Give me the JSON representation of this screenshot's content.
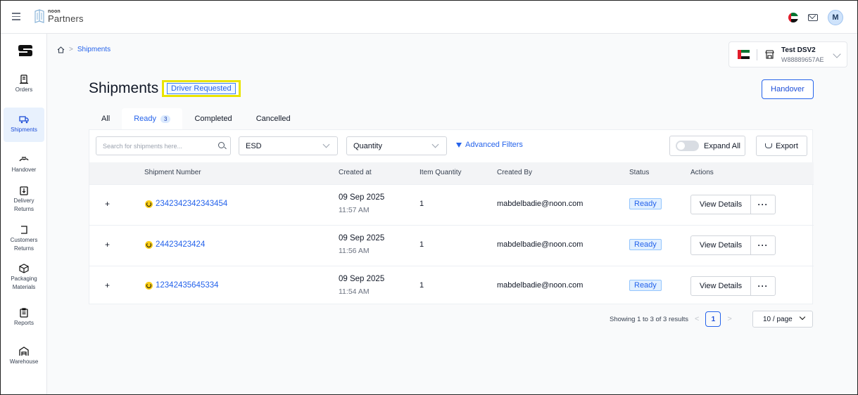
{
  "app": {
    "logo_small": "noon",
    "logo_big": "Partners",
    "avatar_initial": "M"
  },
  "sidebar": {
    "items": [
      {
        "label": "Orders",
        "icon": "orders-icon"
      },
      {
        "label": "Shipments",
        "icon": "truck-icon",
        "active": true
      },
      {
        "label": "Handover",
        "icon": "handover-icon"
      },
      {
        "label": "Delivery Returns",
        "icon": "delivery-returns-icon"
      },
      {
        "label": "Customers Returns",
        "icon": "customer-returns-icon"
      },
      {
        "label": "Packaging Materials",
        "icon": "package-icon"
      },
      {
        "label": "Reports",
        "icon": "reports-icon"
      },
      {
        "label": "Warehouse",
        "icon": "warehouse-icon"
      }
    ]
  },
  "breadcrumb": {
    "current": "Shipments"
  },
  "store": {
    "name": "Test DSV2",
    "id": "W88889657AE"
  },
  "page": {
    "title": "Shipments",
    "status_tag": "Driver Requested",
    "handover_label": "Handover"
  },
  "tabs": [
    {
      "label": "All"
    },
    {
      "label": "Ready",
      "count": "3",
      "active": true
    },
    {
      "label": "Completed"
    },
    {
      "label": "Cancelled"
    }
  ],
  "toolbar": {
    "search_placeholder": "Search for shipments here...",
    "esd_label": "ESD",
    "quantity_label": "Quantity",
    "advanced_filters": "Advanced Filters",
    "expand_all": "Expand All",
    "export": "Export"
  },
  "table": {
    "headers": {
      "shipment": "Shipment Number",
      "created_at": "Created at",
      "qty": "Item Quantity",
      "created_by": "Created By",
      "status": "Status",
      "actions": "Actions"
    },
    "rows": [
      {
        "expand": "+",
        "shipment": "2342342342343454",
        "date": "09 Sep 2025",
        "time": "11:57 AM",
        "qty": "1",
        "created_by": "mabdelbadie@noon.com",
        "status": "Ready",
        "view": "View Details",
        "more": "···"
      },
      {
        "expand": "+",
        "shipment": "24423423424",
        "date": "09 Sep 2025",
        "time": "11:56 AM",
        "qty": "1",
        "created_by": "mabdelbadie@noon.com",
        "status": "Ready",
        "view": "View Details",
        "more": "···"
      },
      {
        "expand": "+",
        "shipment": "12342435645334",
        "date": "09 Sep 2025",
        "time": "11:54 AM",
        "qty": "1",
        "created_by": "mabdelbadie@noon.com",
        "status": "Ready",
        "view": "View Details",
        "more": "···"
      }
    ]
  },
  "pagination": {
    "summary": "Showing 1 to 3 of 3 results",
    "prev": "<",
    "next": ">",
    "current": "1",
    "per_page": "10 / page"
  },
  "colors": {
    "accent": "#2563eb",
    "highlight": "#e9e400",
    "flag_red": "#e11d2b",
    "flag_green": "#00732f"
  }
}
